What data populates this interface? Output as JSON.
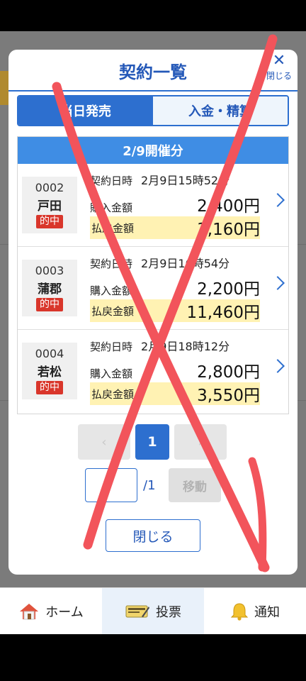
{
  "modal": {
    "title": "契約一覧",
    "close_label": "閉じる"
  },
  "tabs": [
    {
      "label": "当日発売",
      "active": true
    },
    {
      "label": "入金・精算",
      "active": false
    }
  ],
  "date_header": "2/9開催分",
  "fields": {
    "contract_time": "契約日時",
    "purchase": "購入金額",
    "payout": "払戻金額"
  },
  "rows": [
    {
      "no": "0002",
      "venue": "戸田",
      "badge": "的中",
      "datetime": "2月9日15時52分",
      "purchase": "2,400円",
      "payout": "3,160円"
    },
    {
      "no": "0003",
      "venue": "蒲郡",
      "badge": "的中",
      "datetime": "2月9日16時54分",
      "purchase": "2,200円",
      "payout": "11,460円"
    },
    {
      "no": "0004",
      "venue": "若松",
      "badge": "的中",
      "datetime": "2月9日18時12分",
      "purchase": "2,800円",
      "payout": "3,550円"
    }
  ],
  "pager": {
    "prev": "‹",
    "current": "1",
    "next": "›"
  },
  "page_jump": {
    "value": "",
    "total": "/1",
    "move_label": "移動"
  },
  "close_button": "閉じる",
  "nav": [
    {
      "label": "ホーム",
      "icon": "home-icon"
    },
    {
      "label": "投票",
      "icon": "ticket-icon",
      "active": true
    },
    {
      "label": "通知",
      "icon": "bell-icon"
    }
  ],
  "colors": {
    "accent": "#2d6fcf",
    "hit": "#d9362b",
    "payout_bg": "#fff2b3",
    "cross": "#f2545b"
  }
}
